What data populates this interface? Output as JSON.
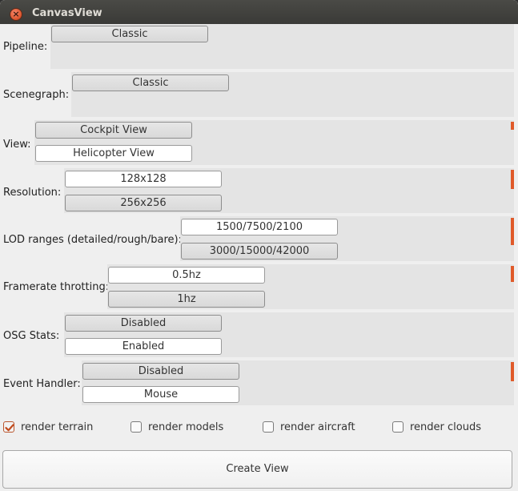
{
  "window": {
    "title": "CanvasView",
    "close_glyph": "×"
  },
  "rows": {
    "pipeline": {
      "label": "Pipeline:",
      "options": [
        "Classic"
      ],
      "selected": 0
    },
    "scenegraph": {
      "label": "Scenegraph:",
      "options": [
        "Classic"
      ],
      "selected": 0
    },
    "view": {
      "label": "View:",
      "options": [
        "Cockpit View",
        "Helicopter View"
      ],
      "selected": 0
    },
    "resolution": {
      "label": "Resolution:",
      "options": [
        "128x128",
        "256x256"
      ],
      "selected": 1
    },
    "lod": {
      "label": "LOD ranges (detailed/rough/bare):",
      "options": [
        "1500/7500/2100",
        "3000/15000/42000"
      ],
      "selected": 1
    },
    "framerate": {
      "label": "Framerate throtting:",
      "options": [
        "0.5hz",
        "1hz"
      ],
      "selected": 1
    },
    "osg_stats": {
      "label": "OSG Stats:",
      "options": [
        "Disabled",
        "Enabled"
      ],
      "selected": 0
    },
    "event_handler": {
      "label": "Event Handler:",
      "options": [
        "Disabled",
        "Mouse"
      ],
      "selected": 0
    }
  },
  "checkboxes": [
    {
      "label": "render terrain",
      "checked": true
    },
    {
      "label": "render models",
      "checked": false
    },
    {
      "label": "render aircraft",
      "checked": false
    },
    {
      "label": "render clouds",
      "checked": false
    }
  ],
  "create_button": {
    "label": "Create View"
  },
  "colors": {
    "accent": "#e05a2a",
    "selected_option_bg": "#dcdcdc",
    "panel_bg": "#e4e4e4"
  }
}
